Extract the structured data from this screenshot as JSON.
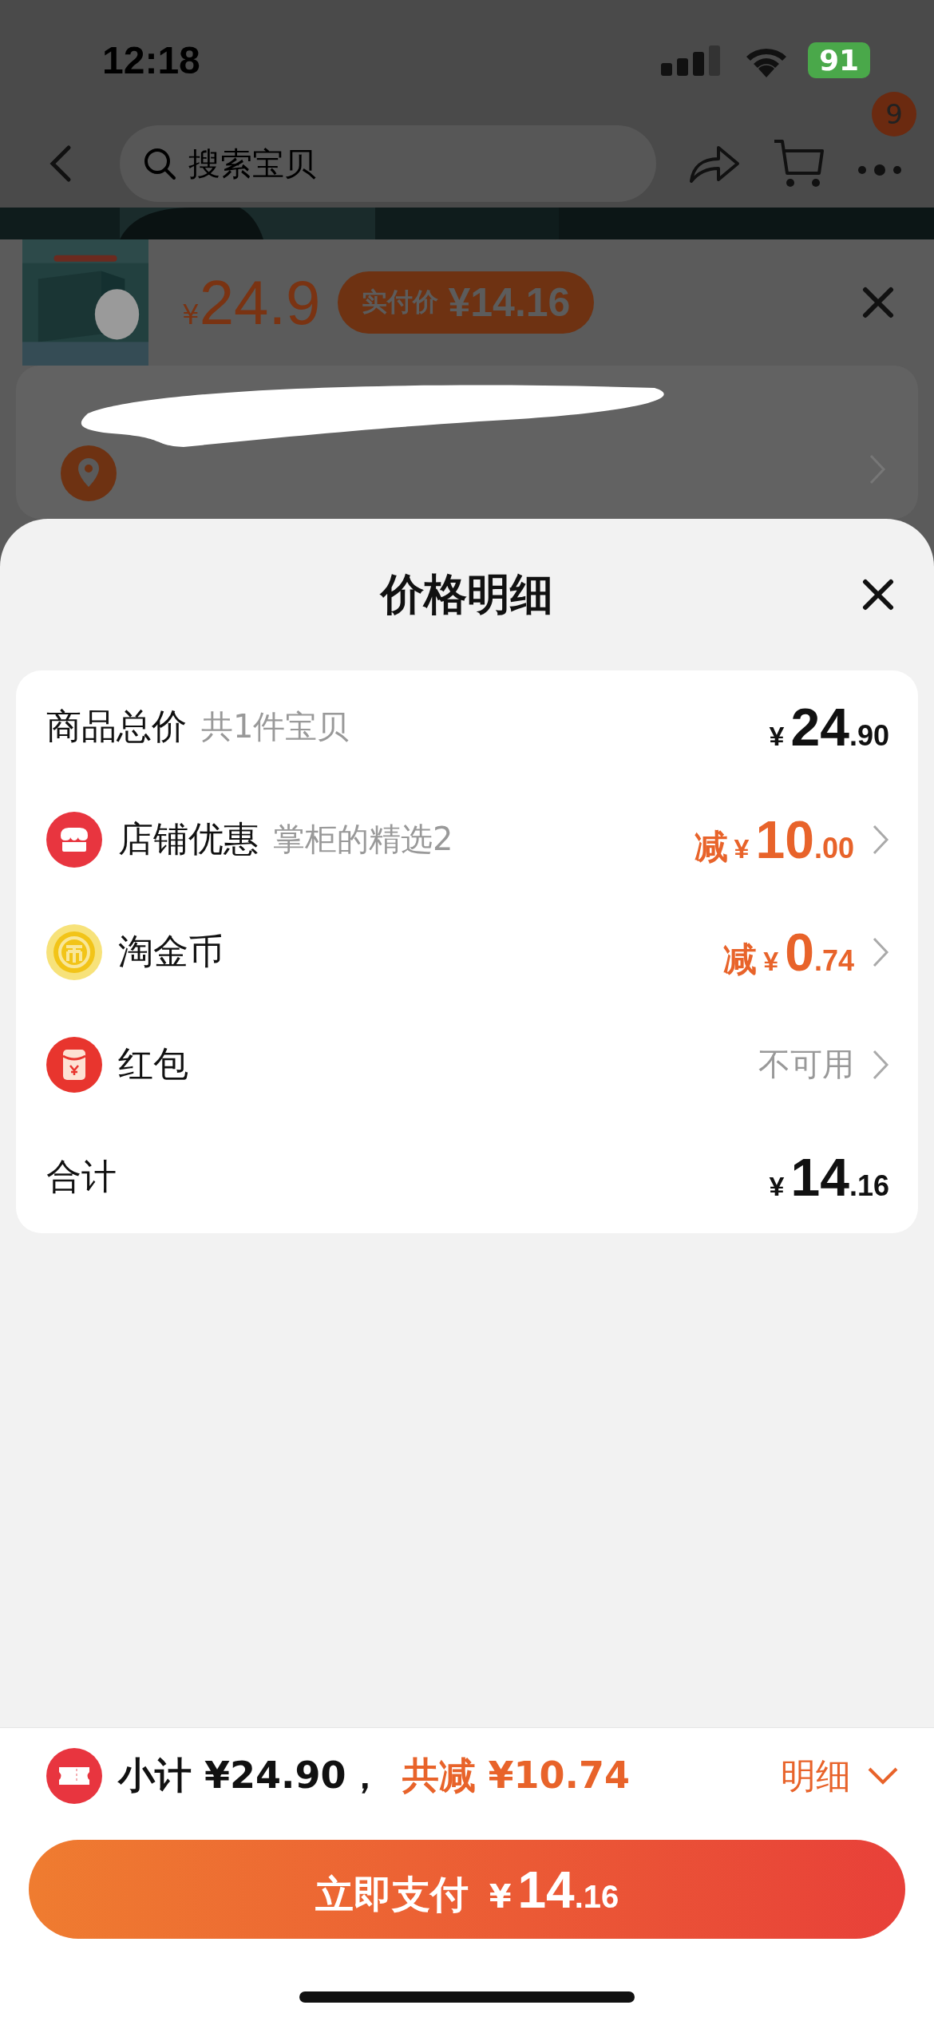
{
  "status_bar": {
    "time": "12:18",
    "battery": "91"
  },
  "nav": {
    "search_placeholder": "搜索宝贝",
    "badge": "9"
  },
  "product": {
    "currency": "¥",
    "price": "24.9",
    "actual_label": "实付价",
    "actual_price": "¥14.16"
  },
  "sheet": {
    "title": "价格明细",
    "rows": [
      {
        "kind": "total",
        "label": "商品总价",
        "note": "共1件宝贝",
        "prefix": "",
        "symbol": "¥",
        "whole": "24",
        "decimal": ".90"
      },
      {
        "kind": "shop_discount",
        "label": "店铺优惠",
        "note": "掌柜的精选2",
        "prefix": "减",
        "symbol": "¥",
        "whole": "10",
        "decimal": ".00"
      },
      {
        "kind": "coin_discount",
        "label": "淘金币",
        "prefix": "减",
        "symbol": "¥",
        "whole": "0",
        "decimal": ".74"
      },
      {
        "kind": "red_packet",
        "label": "红包",
        "status": "不可用"
      },
      {
        "kind": "sum",
        "label": "合计",
        "prefix": "",
        "symbol": "¥",
        "whole": "14",
        "decimal": ".16"
      }
    ]
  },
  "footer": {
    "subtotal": "小计 ¥24.90，",
    "reduction": "共减 ¥10.74",
    "details": "明细",
    "pay_button": {
      "label": "立即支付",
      "symbol": "¥",
      "whole": "14",
      "decimal": ".16"
    }
  }
}
